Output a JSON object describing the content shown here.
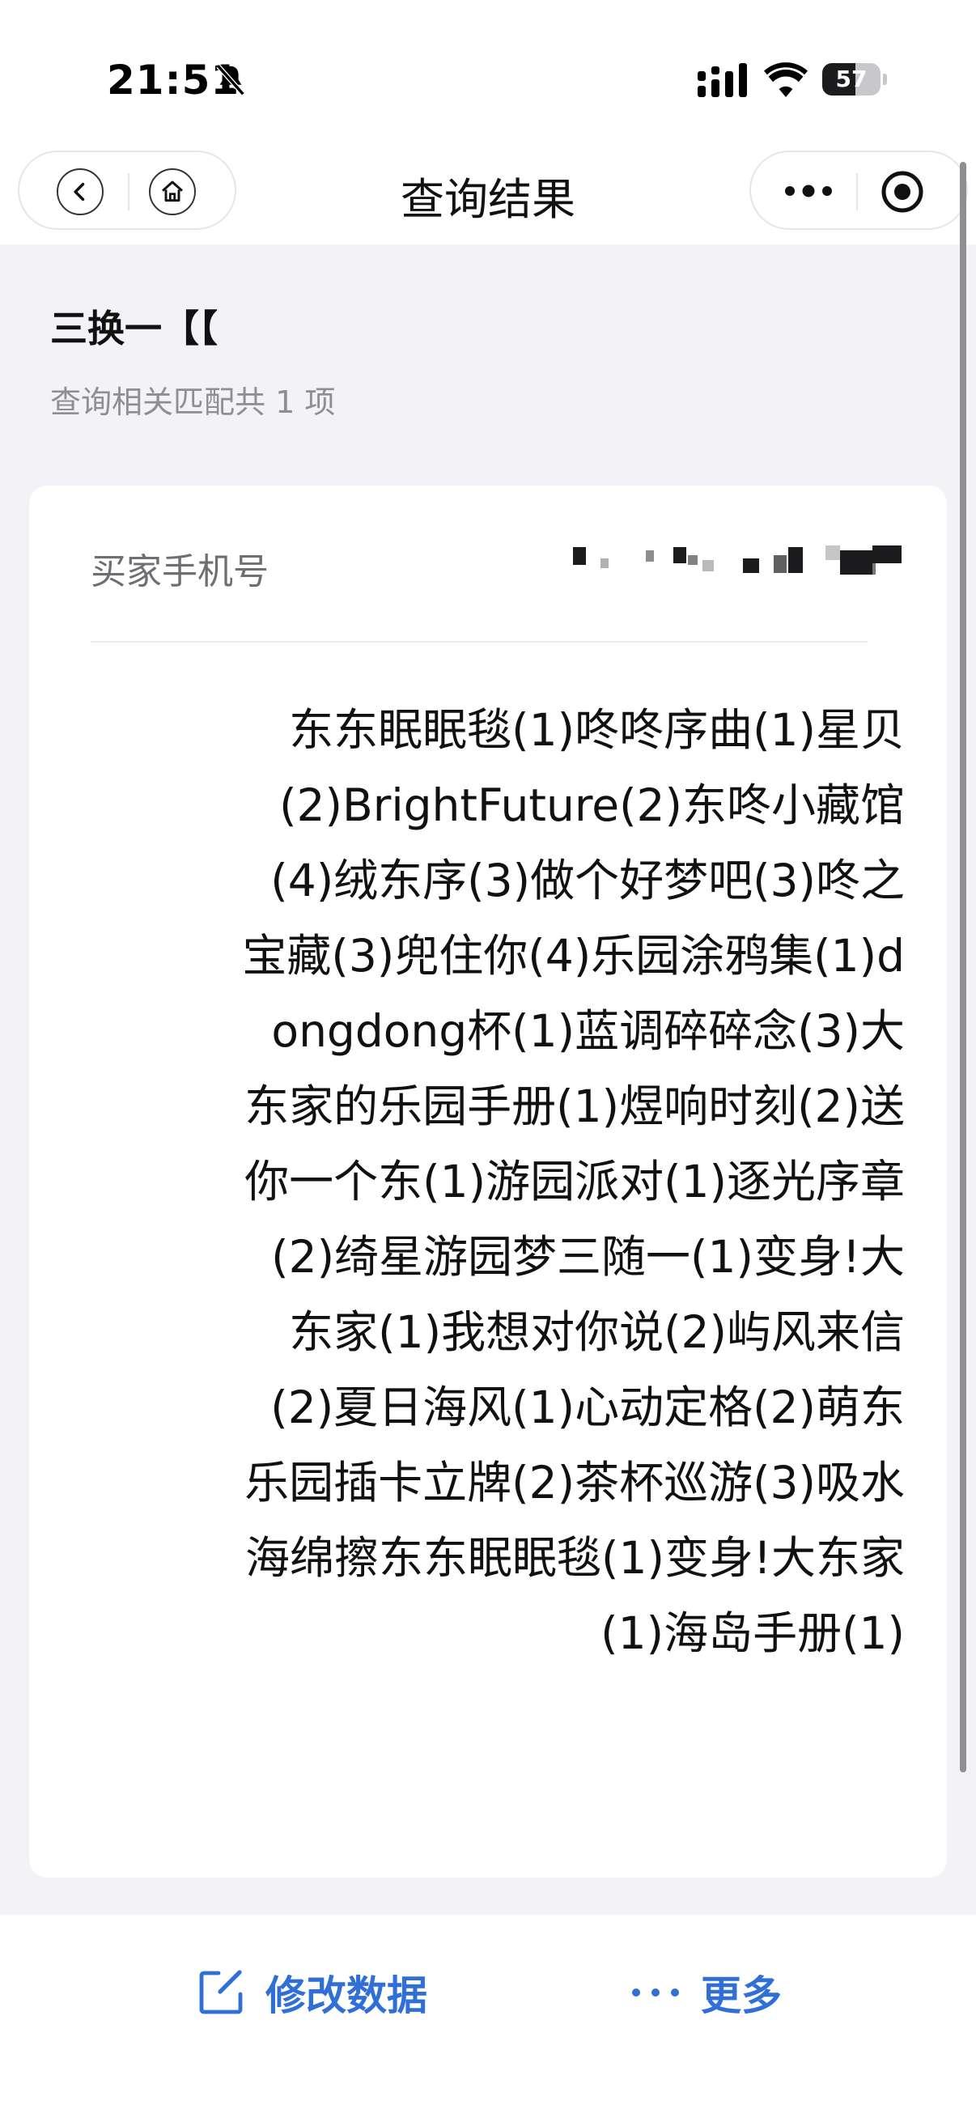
{
  "status_bar": {
    "time": "21:51",
    "battery_level": "57",
    "battery_fraction": 0.57,
    "icons": [
      "bell-off-icon",
      "signal-icon",
      "wifi-icon",
      "battery-icon"
    ]
  },
  "nav": {
    "title": "查询结果",
    "icons": [
      "back-icon",
      "home-icon",
      "more-dots-icon",
      "close-target-icon"
    ]
  },
  "query": {
    "title": "三换一【【",
    "subtitle": "查询相关匹配共 1 项"
  },
  "result": {
    "field_label": "买家手机号",
    "content": "东东眠眠毯(1)咚咚序曲(1)星贝(2)BrightFuture(2)东咚小藏馆(4)绒东序(3)做个好梦吧(3)咚之宝藏(3)兜住你(4)乐园涂鸦集(1)dongdong杯(1)蓝调碎碎念(3)大东家的乐园手册(1)煜响时刻(2)送你一个东(1)游园派对(1)逐光序章(2)绮星游园梦三随一(1)变身!大东家(1)我想对你说(2)屿风来信(2)夏日海风(1)心动定格(2)萌东乐园插卡立牌(2)茶杯巡游(3)吸水海绵擦东东眠眠毯(1)变身!大东家(1)海岛手册(1)"
  },
  "bottom": {
    "edit_label": "修改数据",
    "more_label": "更多",
    "accent_color": "#2f6fd6"
  }
}
